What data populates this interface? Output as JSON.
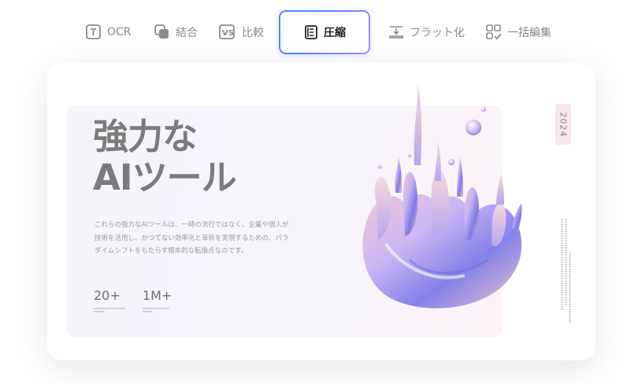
{
  "toolbar": {
    "items": [
      {
        "label": "OCR",
        "icon": "ocr-icon"
      },
      {
        "label": "結合",
        "icon": "merge-icon"
      },
      {
        "label": "比較",
        "icon": "compare-icon"
      },
      {
        "label": "圧縮",
        "icon": "compress-icon",
        "active": true
      },
      {
        "label": "フラット化",
        "icon": "flatten-icon"
      },
      {
        "label": "一括編集",
        "icon": "batch-edit-icon"
      }
    ]
  },
  "hero": {
    "title_line1": "強力な",
    "title_line2": "AIツール",
    "description": "これらの強力なAIツールは、一時の流行ではなく、企業や個人が技術を活用し、かつてない効率化と革新を実現するための、パラダイムシフトをもたらす根本的な転換点なのです。",
    "stats": [
      {
        "value": "20+"
      },
      {
        "value": "1M+"
      }
    ],
    "year": "2024"
  },
  "colors": {
    "active_border_start": "#3f8cff",
    "active_border_end": "#b48cff",
    "year_badge_bg": "#f7e6ee"
  }
}
